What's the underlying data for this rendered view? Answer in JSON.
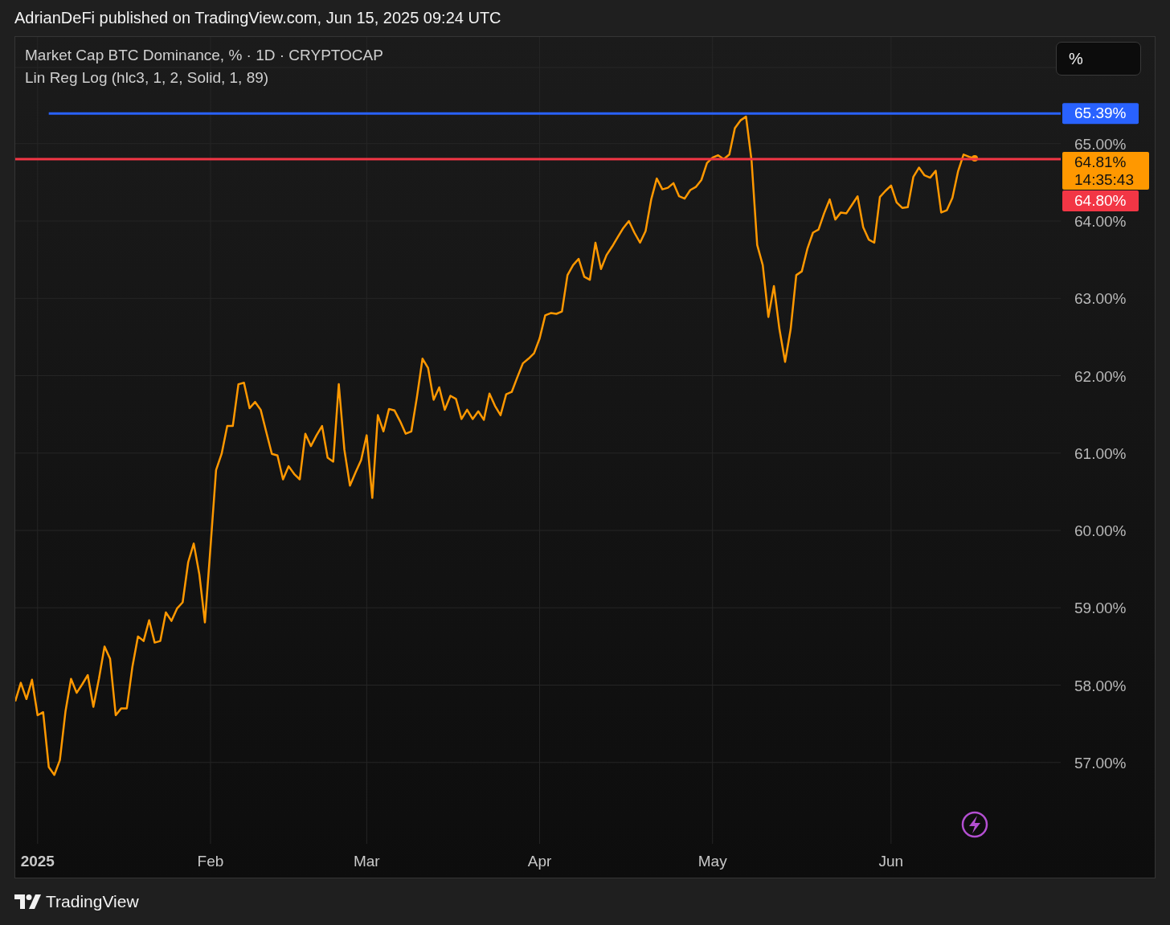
{
  "header": {
    "text": "AdrianDeFi published on TradingView.com, Jun 15, 2025 09:24 UTC"
  },
  "chart": {
    "legend": [
      "Market Cap BTC Dominance, % · 1D · CRYPTOCAP",
      "Lin Reg Log (hlc3, 1, 2, Solid, 1, 89)"
    ],
    "scale_button": "%",
    "last_price_tag": {
      "label": "64.81%",
      "countdown": "14:35:43",
      "color": "#ff9800"
    },
    "level_tags": [
      {
        "label": "65.39%",
        "color": "#2962ff"
      },
      {
        "label": "64.80%",
        "color": "#f23645"
      }
    ],
    "chart_data": {
      "type": "line",
      "grid": true,
      "ylim": [
        56.0,
        66.39
      ],
      "categories": [
        null,
        null,
        null,
        null,
        "2025",
        null,
        null,
        null,
        null,
        null,
        null,
        null,
        null,
        null,
        null,
        null,
        null,
        null,
        null,
        null,
        null,
        null,
        null,
        null,
        null,
        null,
        null,
        null,
        null,
        null,
        null,
        null,
        null,
        null,
        null,
        "Feb",
        null,
        null,
        null,
        null,
        null,
        null,
        null,
        null,
        null,
        null,
        null,
        null,
        null,
        null,
        null,
        null,
        null,
        null,
        null,
        null,
        null,
        null,
        null,
        null,
        null,
        null,
        null,
        "Mar",
        null,
        null,
        null,
        null,
        null,
        null,
        null,
        null,
        null,
        null,
        null,
        null,
        null,
        null,
        null,
        null,
        null,
        null,
        null,
        null,
        null,
        null,
        null,
        null,
        null,
        null,
        null,
        null,
        null,
        null,
        "Apr",
        null,
        null,
        null,
        null,
        null,
        null,
        null,
        null,
        null,
        null,
        null,
        null,
        null,
        null,
        null,
        null,
        null,
        null,
        null,
        null,
        null,
        null,
        null,
        null,
        null,
        null,
        null,
        null,
        null,
        null,
        "May",
        null,
        null,
        null,
        null,
        null,
        null,
        null,
        null,
        null,
        null,
        null,
        null,
        null,
        null,
        null,
        null,
        null,
        null,
        null,
        null,
        null,
        null,
        null,
        null,
        null,
        null,
        null,
        null,
        null,
        null,
        null,
        "Jun",
        null,
        null,
        null,
        null,
        null,
        null,
        null,
        null,
        null,
        null,
        null,
        null,
        null,
        null,
        null
      ],
      "yticks": [
        {
          "value": 57,
          "label": "57.00%"
        },
        {
          "value": 58,
          "label": "58.00%"
        },
        {
          "value": 59,
          "label": "59.00%"
        },
        {
          "value": 60,
          "label": "60.00%"
        },
        {
          "value": 61,
          "label": "61.00%"
        },
        {
          "value": 62,
          "label": "62.00%"
        },
        {
          "value": 63,
          "label": "63.00%"
        },
        {
          "value": 64,
          "label": "64.00%"
        },
        {
          "value": 65,
          "label": "65.00%"
        }
      ],
      "series": [
        {
          "color": "#ff9800",
          "values": [
            57.79,
            58.03,
            57.82,
            58.07,
            57.61,
            57.65,
            56.94,
            56.84,
            57.03,
            57.66,
            58.08,
            57.9,
            58.01,
            58.13,
            57.72,
            58.08,
            58.5,
            58.34,
            57.61,
            57.7,
            57.7,
            58.24,
            58.63,
            58.57,
            58.84,
            58.55,
            58.57,
            58.94,
            58.83,
            58.99,
            59.07,
            59.59,
            59.83,
            59.43,
            58.81,
            59.79,
            60.78,
            60.99,
            61.35,
            61.35,
            61.89,
            61.91,
            61.58,
            61.66,
            61.56,
            61.27,
            60.99,
            60.97,
            60.66,
            60.83,
            60.73,
            60.66,
            61.25,
            61.09,
            61.23,
            61.35,
            60.94,
            60.89,
            61.89,
            61.04,
            60.58,
            60.75,
            60.91,
            61.23,
            60.42,
            61.49,
            61.28,
            61.57,
            61.55,
            61.41,
            61.25,
            61.28,
            61.72,
            62.22,
            62.1,
            61.69,
            61.85,
            61.56,
            61.74,
            61.7,
            61.44,
            61.56,
            61.44,
            61.54,
            61.43,
            61.77,
            61.61,
            61.49,
            61.76,
            61.79,
            61.98,
            62.16,
            62.22,
            62.29,
            62.48,
            62.78,
            62.81,
            62.8,
            62.83,
            63.3,
            63.43,
            63.51,
            63.28,
            63.24,
            63.72,
            63.38,
            63.56,
            63.67,
            63.79,
            63.91,
            64.0,
            63.85,
            63.72,
            63.87,
            64.28,
            64.55,
            64.41,
            64.43,
            64.49,
            64.32,
            64.29,
            64.4,
            64.44,
            64.53,
            64.75,
            64.82,
            64.85,
            64.8,
            64.86,
            65.2,
            65.3,
            65.35,
            64.78,
            63.69,
            63.43,
            62.76,
            63.16,
            62.6,
            62.18,
            62.6,
            63.3,
            63.35,
            63.64,
            63.85,
            63.89,
            64.1,
            64.28,
            64.02,
            64.11,
            64.1,
            64.21,
            64.32,
            63.92,
            63.76,
            63.72,
            64.31,
            64.39,
            64.46,
            64.24,
            64.17,
            64.18,
            64.57,
            64.69,
            64.59,
            64.56,
            64.65,
            64.11,
            64.14,
            64.3,
            64.64,
            64.86,
            64.83,
            64.81
          ]
        },
        {
          "color": "#2962ff",
          "values": [
            null,
            null,
            null,
            null,
            null,
            null,
            65.39,
            null,
            null,
            null,
            null,
            null,
            null,
            null,
            null,
            null,
            null,
            null,
            null,
            null,
            null,
            null,
            null,
            null,
            null,
            null,
            null,
            null,
            null,
            null,
            null,
            null,
            null,
            null,
            null,
            null,
            null,
            null,
            null,
            null,
            null,
            null,
            null,
            null,
            null,
            null,
            null,
            null,
            null,
            null,
            null,
            null,
            null,
            null,
            null,
            null,
            null,
            null,
            null,
            null,
            null,
            null,
            null,
            null,
            null,
            null,
            null,
            null,
            null,
            null,
            null,
            null,
            null,
            null,
            null,
            null,
            null,
            null,
            null,
            null,
            null,
            null,
            null,
            null,
            null,
            null,
            null,
            null,
            null,
            null,
            null,
            null,
            null,
            null,
            null,
            null,
            null,
            null,
            null,
            null,
            null,
            null,
            null,
            null,
            null,
            null,
            null,
            null,
            null,
            null,
            null,
            null,
            null,
            null,
            null,
            null,
            null,
            null,
            null,
            null,
            null,
            null,
            null,
            null,
            null,
            null,
            null,
            null,
            null,
            null,
            null,
            null,
            null,
            null,
            null,
            null,
            null,
            null,
            null,
            null,
            null,
            null,
            null,
            null,
            null,
            null,
            null,
            null,
            null,
            null,
            null,
            null,
            null,
            null,
            null,
            null,
            null,
            null,
            null,
            null,
            null,
            null,
            null,
            null,
            null,
            null,
            null,
            null,
            null,
            null,
            null,
            null,
            65.39
          ]
        },
        {
          "color": "#f23645",
          "values": [
            64.8,
            null,
            null,
            null,
            null,
            null,
            null,
            null,
            null,
            null,
            null,
            null,
            null,
            null,
            null,
            null,
            null,
            null,
            null,
            null,
            null,
            null,
            null,
            null,
            null,
            null,
            null,
            null,
            null,
            null,
            null,
            null,
            null,
            null,
            null,
            null,
            null,
            null,
            null,
            null,
            null,
            null,
            null,
            null,
            null,
            null,
            null,
            null,
            null,
            null,
            null,
            null,
            null,
            null,
            null,
            null,
            null,
            null,
            null,
            null,
            null,
            null,
            null,
            null,
            null,
            null,
            null,
            null,
            null,
            null,
            null,
            null,
            null,
            null,
            null,
            null,
            null,
            null,
            null,
            null,
            null,
            null,
            null,
            null,
            null,
            null,
            null,
            null,
            null,
            null,
            null,
            null,
            null,
            null,
            null,
            null,
            null,
            null,
            null,
            null,
            null,
            null,
            null,
            null,
            null,
            null,
            null,
            null,
            null,
            null,
            null,
            null,
            null,
            null,
            null,
            null,
            null,
            null,
            null,
            null,
            null,
            null,
            null,
            null,
            null,
            null,
            null,
            null,
            null,
            null,
            null,
            null,
            null,
            null,
            null,
            null,
            null,
            null,
            null,
            null,
            null,
            null,
            null,
            null,
            null,
            null,
            null,
            null,
            null,
            null,
            null,
            null,
            null,
            null,
            null,
            null,
            null,
            null,
            null,
            null,
            null,
            null,
            null,
            null,
            null,
            null,
            null,
            null,
            null,
            null,
            null,
            null,
            64.8
          ]
        }
      ]
    }
  },
  "footer": {
    "brand": "TradingView"
  }
}
